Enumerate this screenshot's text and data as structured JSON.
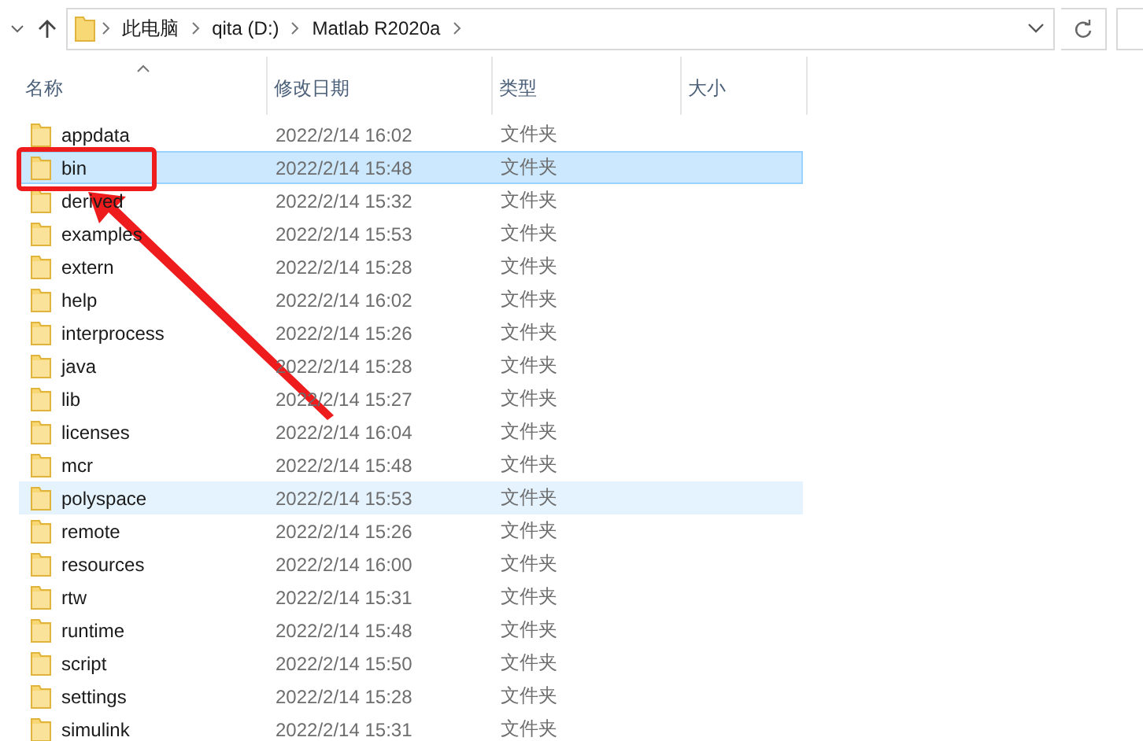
{
  "address_bar": {
    "breadcrumbs": [
      "此电脑",
      "qita (D:)",
      "Matlab R2020a"
    ]
  },
  "table": {
    "columns": [
      {
        "label": "名称",
        "sorted": true
      },
      {
        "label": "修改日期",
        "sorted": false
      },
      {
        "label": "类型",
        "sorted": false
      },
      {
        "label": "大小",
        "sorted": false
      }
    ],
    "rows": [
      {
        "name": "appdata",
        "modified": "2022/2/14 16:02",
        "type": "文件夹",
        "selected": false,
        "hovered": false
      },
      {
        "name": "bin",
        "modified": "2022/2/14 15:48",
        "type": "文件夹",
        "selected": true,
        "hovered": false
      },
      {
        "name": "derived",
        "modified": "2022/2/14 15:32",
        "type": "文件夹",
        "selected": false,
        "hovered": false
      },
      {
        "name": "examples",
        "modified": "2022/2/14 15:53",
        "type": "文件夹",
        "selected": false,
        "hovered": false
      },
      {
        "name": "extern",
        "modified": "2022/2/14 15:28",
        "type": "文件夹",
        "selected": false,
        "hovered": false
      },
      {
        "name": "help",
        "modified": "2022/2/14 16:02",
        "type": "文件夹",
        "selected": false,
        "hovered": false
      },
      {
        "name": "interprocess",
        "modified": "2022/2/14 15:26",
        "type": "文件夹",
        "selected": false,
        "hovered": false
      },
      {
        "name": "java",
        "modified": "2022/2/14 15:28",
        "type": "文件夹",
        "selected": false,
        "hovered": false
      },
      {
        "name": "lib",
        "modified": "2022/2/14 15:27",
        "type": "文件夹",
        "selected": false,
        "hovered": false
      },
      {
        "name": "licenses",
        "modified": "2022/2/14 16:04",
        "type": "文件夹",
        "selected": false,
        "hovered": false
      },
      {
        "name": "mcr",
        "modified": "2022/2/14 15:48",
        "type": "文件夹",
        "selected": false,
        "hovered": false
      },
      {
        "name": "polyspace",
        "modified": "2022/2/14 15:53",
        "type": "文件夹",
        "selected": false,
        "hovered": true
      },
      {
        "name": "remote",
        "modified": "2022/2/14 15:26",
        "type": "文件夹",
        "selected": false,
        "hovered": false
      },
      {
        "name": "resources",
        "modified": "2022/2/14 16:00",
        "type": "文件夹",
        "selected": false,
        "hovered": false
      },
      {
        "name": "rtw",
        "modified": "2022/2/14 15:31",
        "type": "文件夹",
        "selected": false,
        "hovered": false
      },
      {
        "name": "runtime",
        "modified": "2022/2/14 15:48",
        "type": "文件夹",
        "selected": false,
        "hovered": false
      },
      {
        "name": "script",
        "modified": "2022/2/14 15:50",
        "type": "文件夹",
        "selected": false,
        "hovered": false
      },
      {
        "name": "settings",
        "modified": "2022/2/14 15:28",
        "type": "文件夹",
        "selected": false,
        "hovered": false
      },
      {
        "name": "simulink",
        "modified": "2022/2/14 15:31",
        "type": "文件夹",
        "selected": false,
        "hovered": false
      }
    ]
  }
}
